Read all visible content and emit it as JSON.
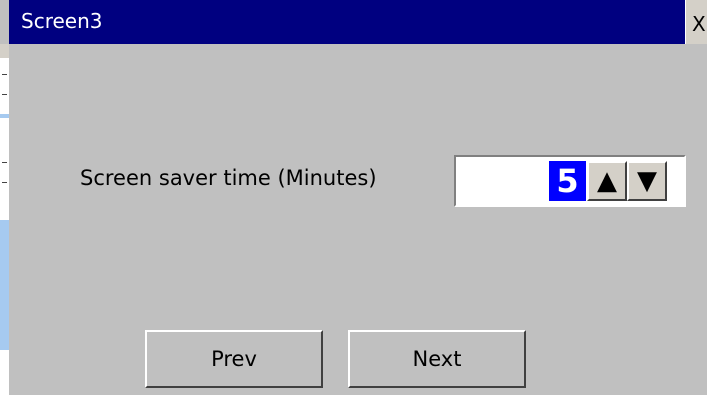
{
  "window": {
    "title": "Screen3",
    "close_label": "X"
  },
  "setting": {
    "label": "Screen saver time (Minutes)",
    "value": "5",
    "up_glyph": "▲",
    "down_glyph": "▼"
  },
  "navigation": {
    "prev_label": "Prev",
    "next_label": "Next"
  },
  "colors": {
    "titlebar": "#000080",
    "background": "#c0c0c0",
    "value_highlight": "#0000ff"
  }
}
